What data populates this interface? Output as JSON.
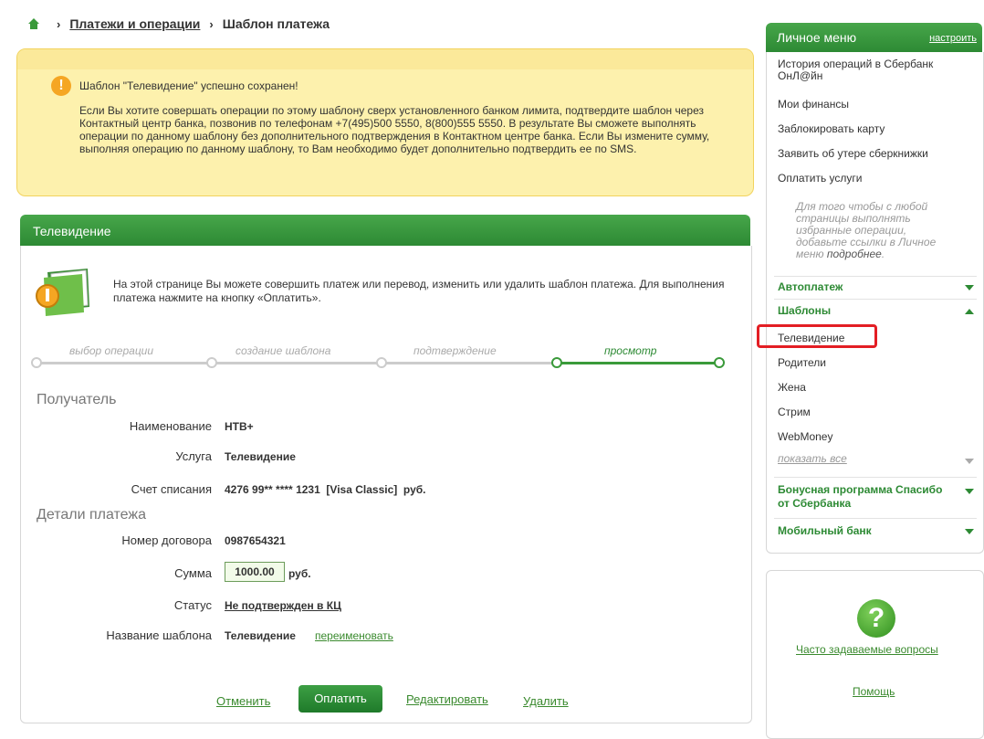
{
  "breadcrumb": {
    "section": "Платежи и операции",
    "current": "Шаблон платежа"
  },
  "alert": {
    "title": "Шаблон \"Телевидение\" успешно сохранен!",
    "text": "Если Вы хотите совершать операции по этому шаблону сверх установленного банком лимита, подтвердите шаблон через Контактный центр банка, позвонив по телефонам +7(495)500 5550, 8(800)555 5550. В результате Вы сможете выполнять операции по данному шаблону без дополнительного подтверждения в Контактном центре банка. Если Вы измените сумму, выполняя операцию по данному шаблону, то Вам необходимо будет дополнительно подтвердить ее по SMS."
  },
  "panel": {
    "title": "Телевидение",
    "intro": "На этой странице Вы можете совершить платеж или перевод, изменить или удалить шаблон платежа. Для выполнения платежа нажмите на кнопку «Оплатить».",
    "steps": [
      "выбор операции",
      "создание шаблона",
      "подтверждение",
      "просмотр"
    ]
  },
  "recipient": {
    "section": "Получатель",
    "name_label": "Наименование",
    "name": "НТВ+",
    "service_label": "Услуга",
    "service": "Телевидение",
    "account_label": "Счет списания",
    "account": "4276 99** **** 1231  [Visa Classic]  руб."
  },
  "details": {
    "section": "Детали платежа",
    "contract_label": "Номер договора",
    "contract": "0987654321",
    "amount_label": "Сумма",
    "amount": "1000.00",
    "currency": "руб.",
    "status_label": "Статус",
    "status": "Не подтвержден в КЦ",
    "template_label": "Название шаблона",
    "template": "Телевидение",
    "rename": "переименовать"
  },
  "actions": {
    "cancel": "Отменить",
    "pay": "Оплатить",
    "edit": "Редактировать",
    "delete": "Удалить"
  },
  "sidebar": {
    "title": "Личное меню",
    "configure": "настроить",
    "items": [
      "История операций в Сбербанк ОнЛ@йн",
      "Мои финансы",
      "Заблокировать карту",
      "Заявить об утере сберкнижки",
      "Оплатить услуги"
    ],
    "note": "Для того чтобы с любой страницы выполнять избранные операции, добавьте ссылки в Личное меню",
    "note_link": "подробнее",
    "autopay": "Автоплатеж",
    "templates": "Шаблоны",
    "template_items": [
      "Телевидение",
      "Родители",
      "Жена",
      "Стрим",
      "WebMoney"
    ],
    "show_all": "показать все",
    "bonus": "Бонусная программа Спасибо от Сбербанка",
    "mobile": "Мобильный банк"
  },
  "help": {
    "faq": "Часто задаваемые вопросы",
    "help": "Помощь"
  },
  "colors": {
    "brand_green": "#2d8a34",
    "alert_bg": "#fdf1ad",
    "highlight": "#e31e24"
  }
}
